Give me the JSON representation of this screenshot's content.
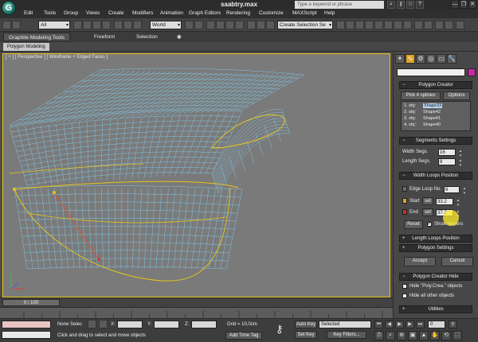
{
  "app": {
    "title": "saabtry.max",
    "search_placeholder": "Type a keyword or phrase",
    "logo_glyph": "G",
    "accent_color": "#e6c51a",
    "window_buttons": [
      "—",
      "❐",
      "✕"
    ]
  },
  "menu": [
    "Edit",
    "Tools",
    "Group",
    "Views",
    "Create",
    "Modifiers",
    "Animation",
    "Graph Editors",
    "Rendering",
    "Customize",
    "MAXScript",
    "Help"
  ],
  "toolbar": {
    "filter_value": "All",
    "coord_value": "World",
    "selection_set_value": "Create Selection Se"
  },
  "ribbon": {
    "tabs": [
      "Graphite Modeling Tools",
      "Freeform",
      "Selection"
    ],
    "sub_tab": "Polygon Modeling"
  },
  "viewport": {
    "label": "[ + ] [ Perspective ] [ Wireframe + Edged Faces ]",
    "wire_color": "#7fc4e4",
    "spline_color": "#e6c51a",
    "spline_segment_color": "#e0502a"
  },
  "timeline": {
    "frame_display": "0 / 100"
  },
  "panel": {
    "tab_icons": [
      "wand-icon",
      "curve-icon",
      "hierarchy-icon",
      "motion-icon",
      "display-icon",
      "utilities-icon"
    ],
    "tab_glyphs": [
      "✦",
      "∿",
      "⚙",
      "◎",
      "▭",
      "🔧"
    ],
    "object_color": "#c92aa5",
    "polygon_creator": {
      "header": "Polygon Creator",
      "pick_button": "Pick 4 splines",
      "options_button": "Options",
      "list": [
        {
          "index": "1. obj:",
          "name": "Shape33"
        },
        {
          "index": "2. obj:",
          "name": "Shape42"
        },
        {
          "index": "3. obj:",
          "name": "Shape41"
        },
        {
          "index": "4. obj:",
          "name": "Shape40"
        }
      ]
    },
    "segments": {
      "header": "Segments Settings",
      "width_label": "Width Segs.",
      "width_value": "16",
      "length_label": "Length Segs.",
      "length_value": "8"
    },
    "width_loops": {
      "header": "Width Loops Position",
      "edge_loop_label": "Edge Loop No.",
      "edge_loop_value": "6",
      "start_label": "Start",
      "start_set": "set",
      "start_value": "33.2",
      "end_label": "End",
      "end_set": "set",
      "end_value": "37.2",
      "start_color": "#e0a428",
      "end_color": "#c03030",
      "reset_button": "Reset",
      "show_helpers_label": "Show helpers",
      "show_helpers_checked": true
    },
    "length_loops_header": "Length Loops Position",
    "polygon_settings_header": "Polygon Settings",
    "accept_button": "Accept",
    "cancel_button": "Cancel",
    "hide": {
      "header": "Polygon Creator Hide",
      "hide_poly_label": "Hide \"Poly.Crea.\" objects",
      "hide_others_label": "Hide all other objects"
    },
    "utilities_header": "Utilities"
  },
  "statusbar": {
    "selection_status": "None Selec",
    "prompt": "Click and drag to select and move objects",
    "x_label": "X:",
    "y_label": "Y:",
    "z_label": "Z:",
    "grid": "Grid = 10,0cm",
    "add_time_tag": "Add Time Tag",
    "auto_key": "Auto Key",
    "set_key": "Set Key",
    "selected_value": "Selected",
    "key_filters": "Key Filters...",
    "frame_value": "0"
  }
}
